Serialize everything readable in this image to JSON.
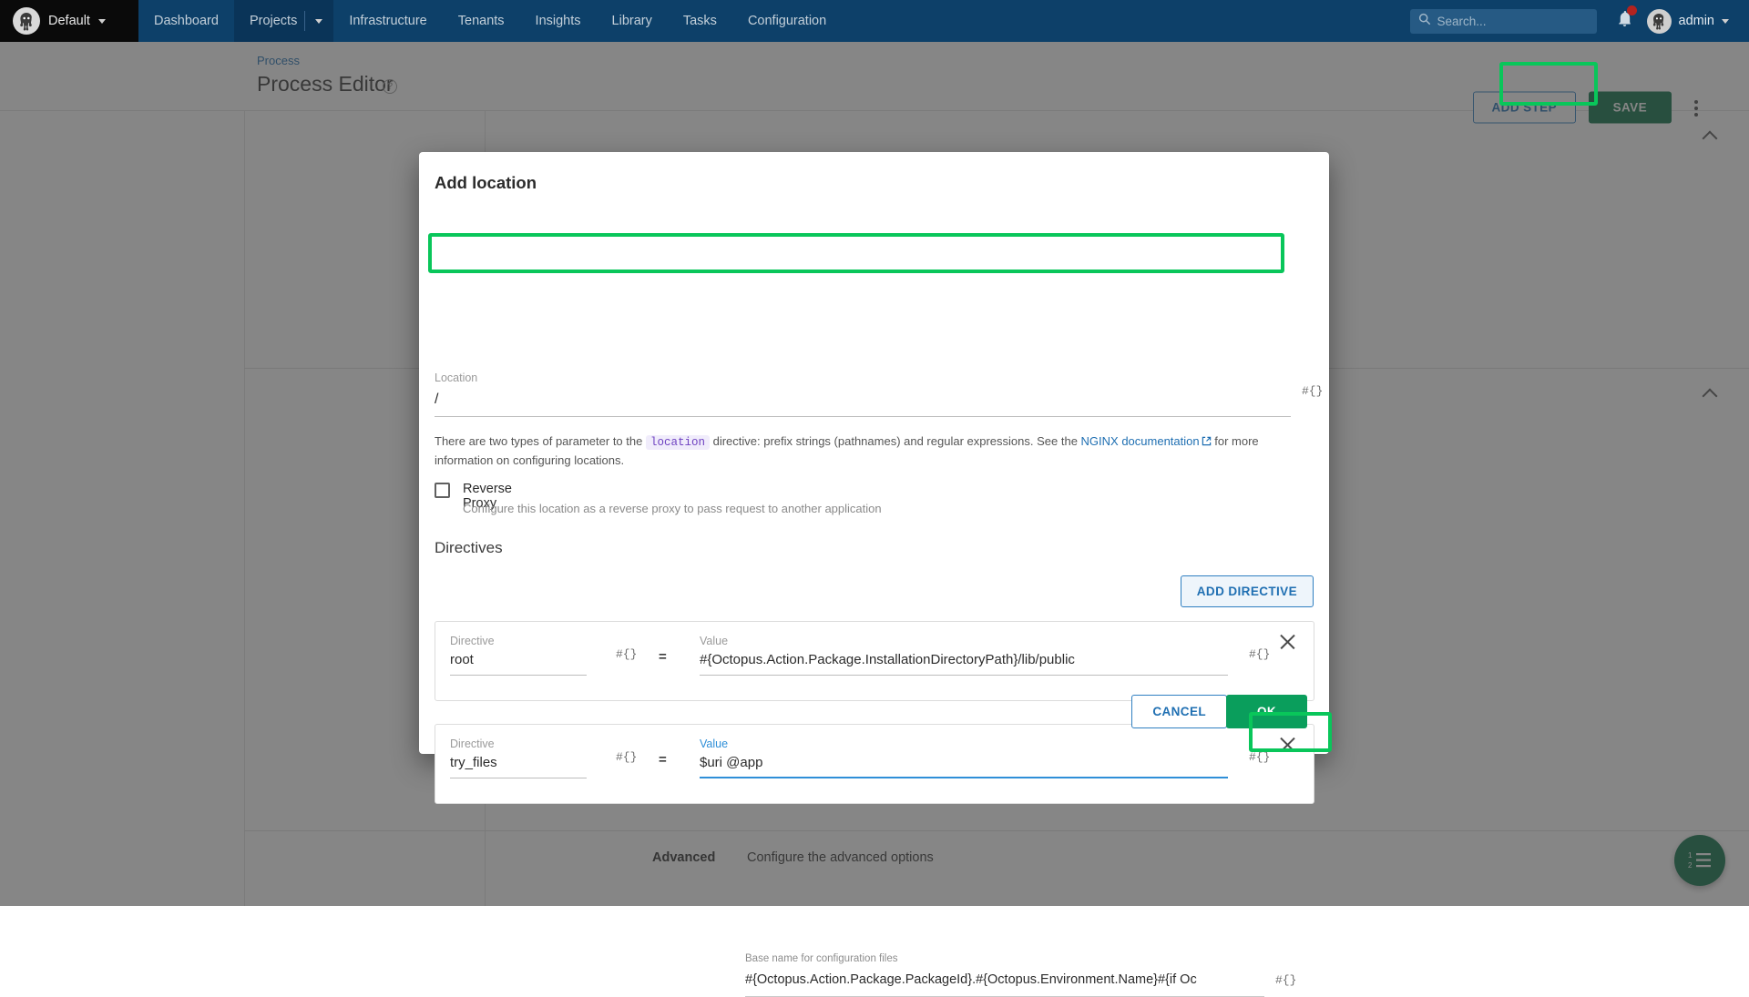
{
  "topnav": {
    "space": "Default",
    "items": [
      {
        "label": "Dashboard",
        "active": false
      },
      {
        "label": "Projects",
        "active": true
      },
      {
        "label": "Infrastructure",
        "active": false
      },
      {
        "label": "Tenants",
        "active": false
      },
      {
        "label": "Insights",
        "active": false
      },
      {
        "label": "Library",
        "active": false
      },
      {
        "label": "Tasks",
        "active": false
      },
      {
        "label": "Configuration",
        "active": false
      }
    ],
    "search_placeholder": "Search...",
    "user": "admin",
    "notification_badge": "",
    "colors": {
      "bar": "#0d4069",
      "active_item": "#0a3458",
      "space_chip": "#0a0a0a",
      "badge": "#b3231f"
    }
  },
  "page": {
    "breadcrumb": "Process",
    "title": "Process Editor",
    "help_icon_label": "?",
    "add_step_label": "ADD STEP",
    "save_label": "SAVE",
    "advanced": {
      "label": "Advanced",
      "description": "Configure the advanced options",
      "field_label": "Base name for configuration files",
      "field_value": "#{Octopus.Action.Package.PackageId}.#{Octopus.Environment.Name}#{if Oc",
      "variable_icon": "#{}"
    }
  },
  "modal": {
    "title": "Add location",
    "location": {
      "label": "Location",
      "value": "/",
      "variable_icon": "#{}",
      "highlighted": true
    },
    "help": {
      "before": "There are two types of parameter to the",
      "code": "location",
      "middle": "directive: prefix strings (pathnames) and regular expressions. See the",
      "link": "NGINX documentation",
      "after": "for more information on configuring locations."
    },
    "reverse_proxy": {
      "label": "Reverse Proxy",
      "description": "Configure this location as a reverse proxy to pass request to another application",
      "checked": false
    },
    "directives_section_title": "Directives",
    "add_directive_label": "ADD DIRECTIVE",
    "directives": [
      {
        "name_label": "Directive",
        "name_value": "root",
        "value_label": "Value",
        "value_value": "#{Octopus.Action.Package.InstallationDirectoryPath}/lib/public",
        "equals": "=",
        "variable_icon": "#{}",
        "focused": false
      },
      {
        "name_label": "Directive",
        "name_value": "try_files",
        "value_label": "Value",
        "value_value": "$uri @app",
        "equals": "=",
        "variable_icon": "#{}",
        "focused": true
      }
    ],
    "cancel_label": "CANCEL",
    "ok_label": "OK",
    "colors": {
      "ok": "#0a9e5c",
      "highlight": "#09c65a",
      "link": "#1f6fb2",
      "focus": "#2f8fd8"
    }
  }
}
